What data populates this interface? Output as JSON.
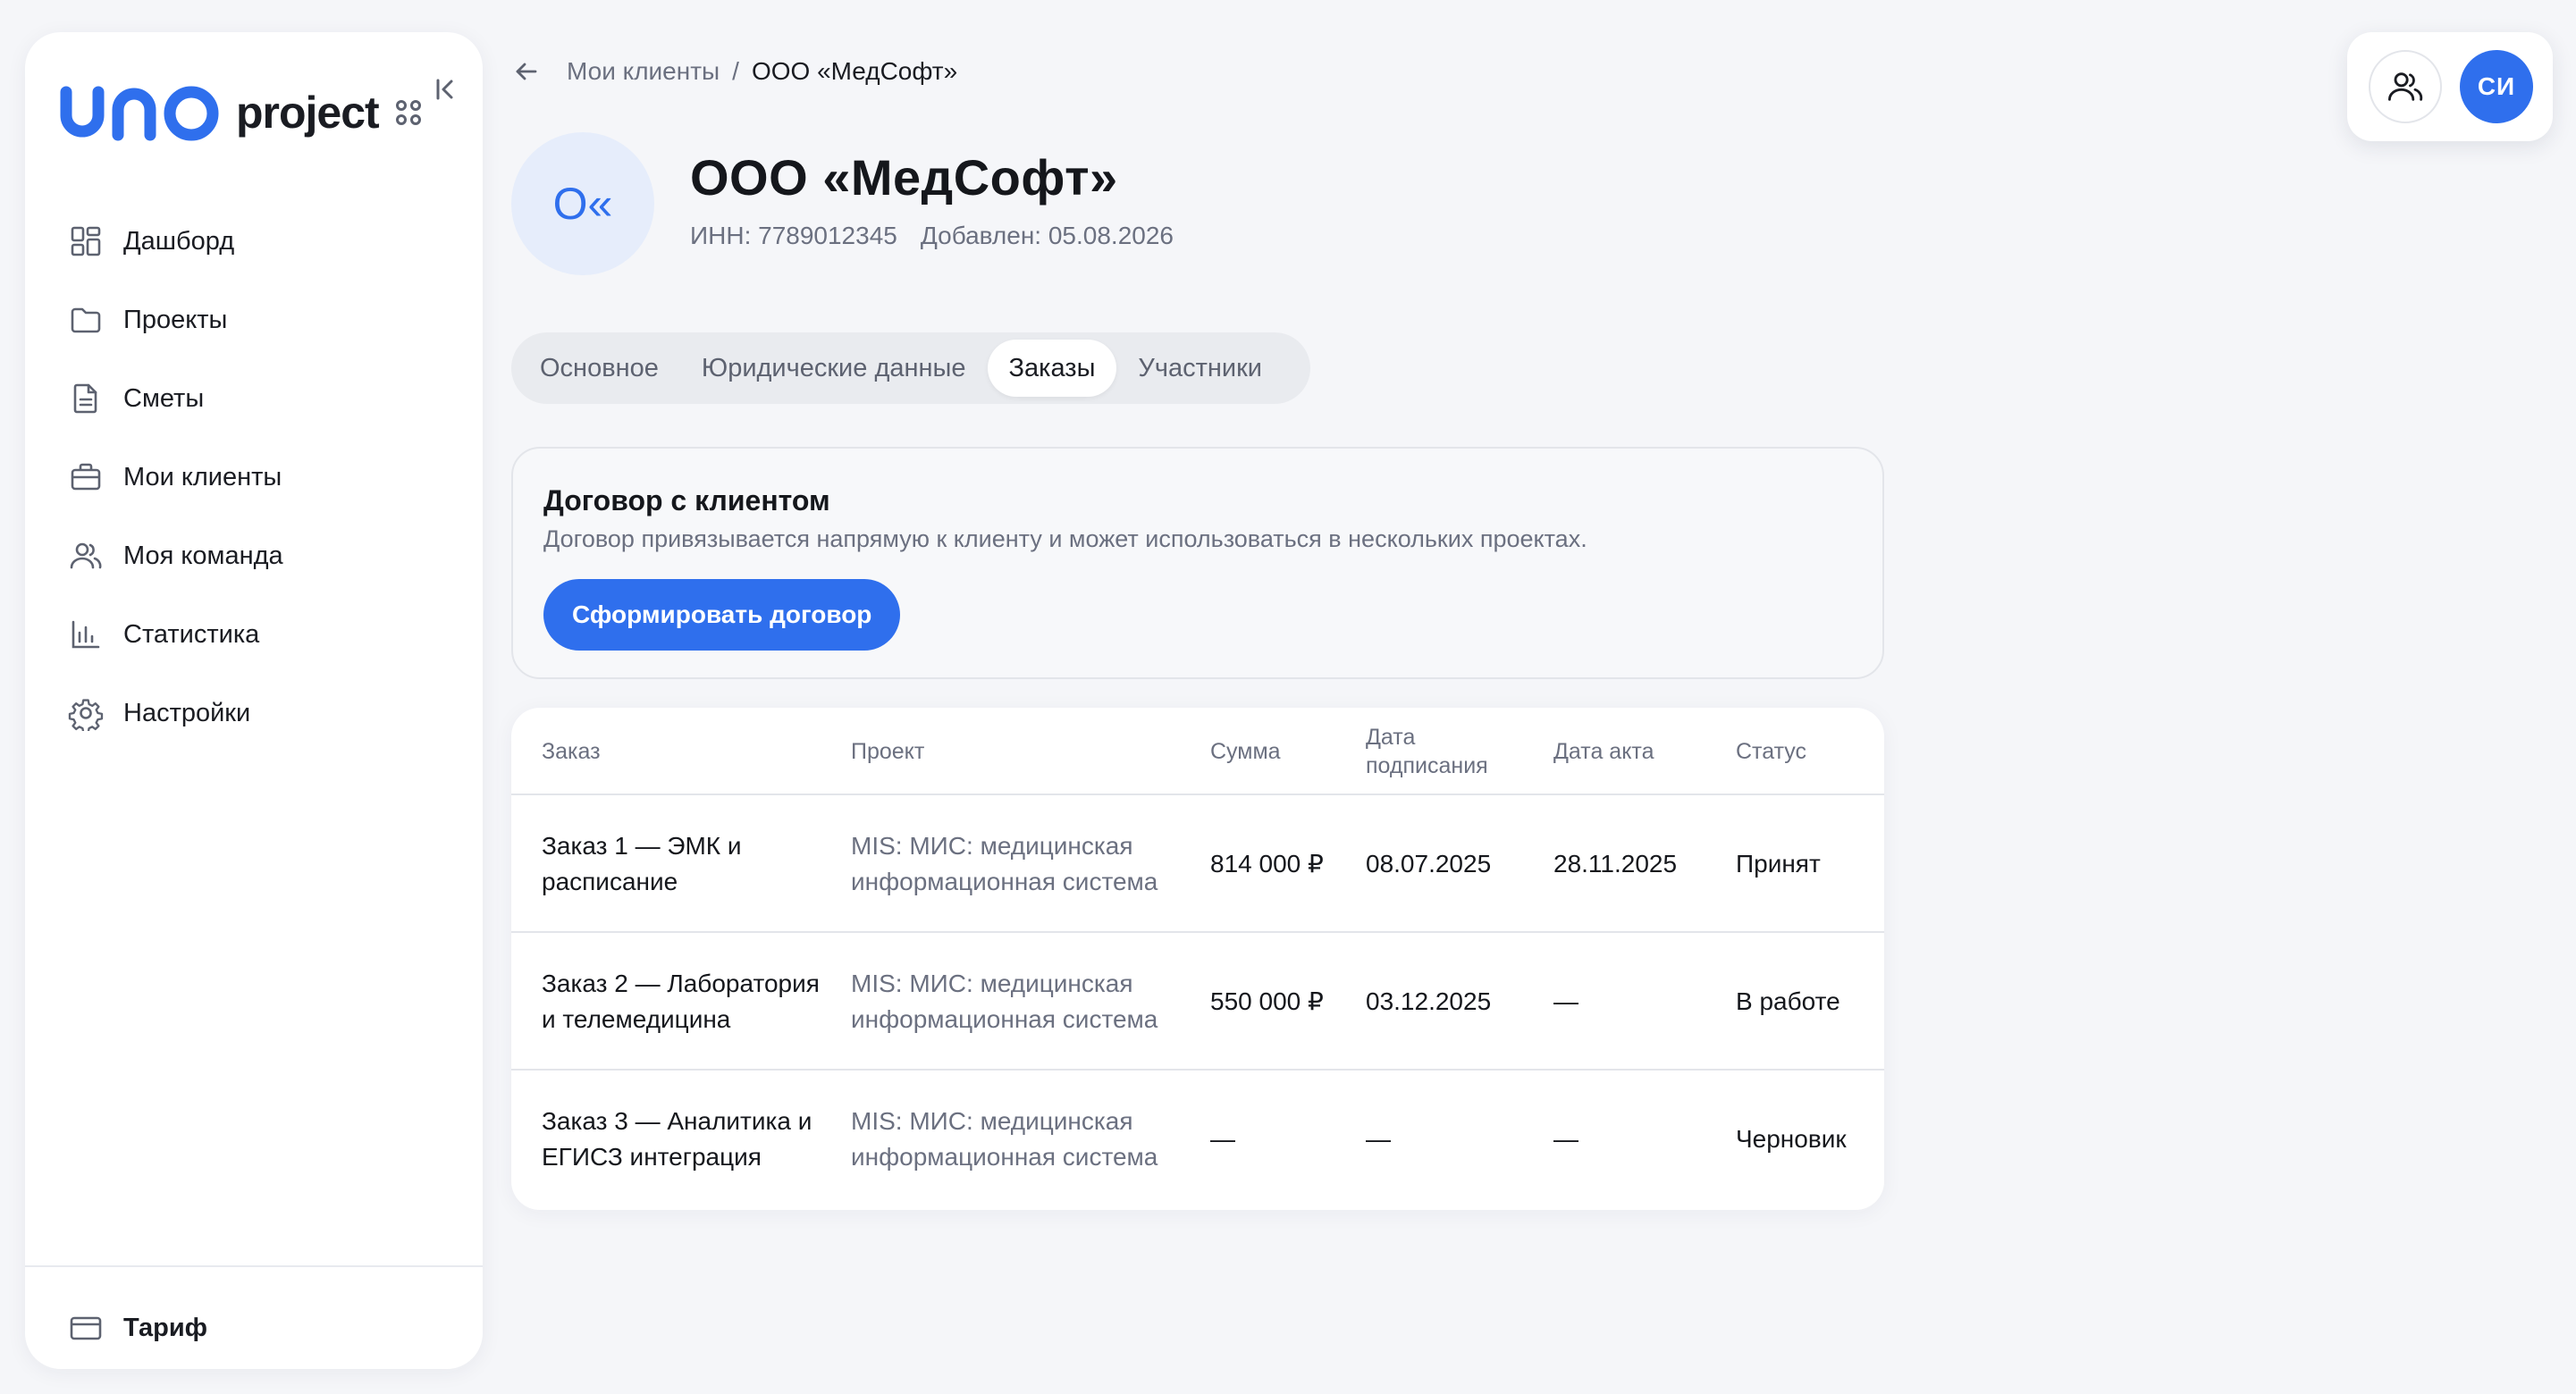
{
  "app": {
    "logo_brand": "uno",
    "logo_text": "project"
  },
  "sidebar": {
    "items": [
      {
        "label": "Дашборд",
        "icon": "dashboard-icon"
      },
      {
        "label": "Проекты",
        "icon": "folder-icon"
      },
      {
        "label": "Сметы",
        "icon": "document-icon"
      },
      {
        "label": "Мои клиенты",
        "icon": "briefcase-icon"
      },
      {
        "label": "Моя команда",
        "icon": "team-icon"
      },
      {
        "label": "Статистика",
        "icon": "chart-icon"
      },
      {
        "label": "Настройки",
        "icon": "gear-icon"
      }
    ],
    "tariff_label": "Тариф"
  },
  "header": {
    "avatar_initials": "СИ"
  },
  "breadcrumb": {
    "parent": "Мои клиенты",
    "separator": "/",
    "current": "ООО «МедСофт»"
  },
  "client": {
    "avatar_initials": "О«",
    "name": "ООО «МедСофт»",
    "inn": "ИНН: 7789012345",
    "added": "Добавлен: 05.08.2026"
  },
  "tabs": [
    {
      "label": "Основное",
      "active": false
    },
    {
      "label": "Юридические данные",
      "active": false
    },
    {
      "label": "Заказы",
      "active": true
    },
    {
      "label": "Участники",
      "active": false
    }
  ],
  "contract": {
    "title": "Договор с клиентом",
    "description": "Договор привязывается напрямую к клиенту и может использоваться в нескольких проектах.",
    "button_label": "Сформировать договор"
  },
  "orders": {
    "columns": [
      "Заказ",
      "Проект",
      "Сумма",
      "Дата подписания",
      "Дата акта",
      "Статус"
    ],
    "rows": [
      {
        "order": "Заказ 1 — ЭМК и расписание",
        "project": "MIS: МИС: медицинская информационная система",
        "amount": "814 000 ₽",
        "signed": "08.07.2025",
        "act": "28.11.2025",
        "status": "Принят"
      },
      {
        "order": "Заказ 2 — Лаборатория и телемедицина",
        "project": "MIS: МИС: медицинская информационная система",
        "amount": "550 000 ₽",
        "signed": "03.12.2025",
        "act": "—",
        "status": "В работе"
      },
      {
        "order": "Заказ 3 — Аналитика и ЕГИСЗ интеграция",
        "project": "MIS: МИС: медицинская информационная система",
        "amount": "—",
        "signed": "—",
        "act": "—",
        "status": "Черновик"
      }
    ]
  },
  "colors": {
    "accent": "#2f6fed",
    "background": "#f5f6f9",
    "muted_text": "#6b7080"
  }
}
